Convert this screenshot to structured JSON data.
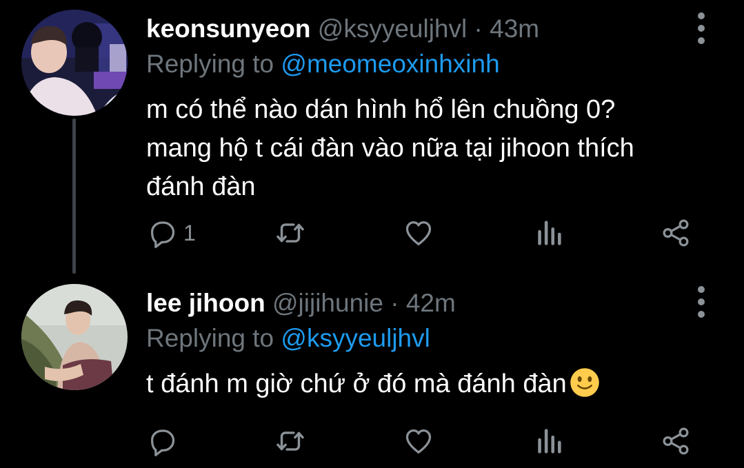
{
  "colors": {
    "background": "#000000",
    "text_primary": "#ffffff",
    "text_secondary": "#6e767d",
    "link": "#1d9bf0",
    "icon": "#8b9298",
    "thread_line": "#3d4349"
  },
  "tweets": [
    {
      "display_name": "keonsunyeon",
      "handle": "@ksyyeuljhvl",
      "separator": "·",
      "time": "43m",
      "replying_label": "Replying to",
      "replying_to": "@meomeoxinhxinh",
      "text_lines": [
        "m có thể nào dán hình hổ lên chuồng 0?",
        "mang hộ t cái đàn vào nữa tại jihoon thích",
        "đánh đàn"
      ],
      "reply_count": "1",
      "icons": [
        "reply-icon",
        "retweet-icon",
        "like-icon",
        "analytics-icon",
        "share-icon",
        "more-icon"
      ]
    },
    {
      "display_name": "lee jihoon",
      "handle": "@jijihunie",
      "separator": "·",
      "time": "42m",
      "replying_label": "Replying to",
      "replying_to": "@ksyyeuljhvl",
      "text_lines": [
        "t đánh m giờ chứ ở đó mà đánh đàn"
      ],
      "emoji": "slightly-smiling-face",
      "reply_count": "",
      "icons": [
        "reply-icon",
        "retweet-icon",
        "like-icon",
        "analytics-icon",
        "share-icon",
        "more-icon"
      ]
    }
  ]
}
